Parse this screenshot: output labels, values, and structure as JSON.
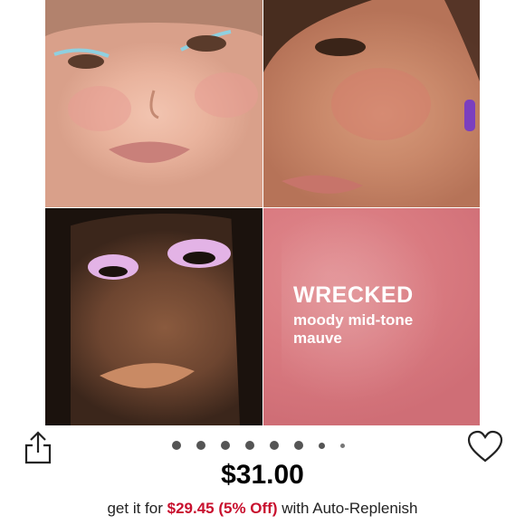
{
  "promo": {
    "title": "WRECKED",
    "description": "moody mid-tone mauve"
  },
  "price": "$31.00",
  "auto_replenish": {
    "prefix": "get it for",
    "discount": "$29.45 (5% Off)",
    "suffix": "with Auto-Replenish"
  },
  "carousel": {
    "total": 8,
    "active": 1
  },
  "icons": {
    "share": "share-icon",
    "favorite": "heart-icon"
  }
}
